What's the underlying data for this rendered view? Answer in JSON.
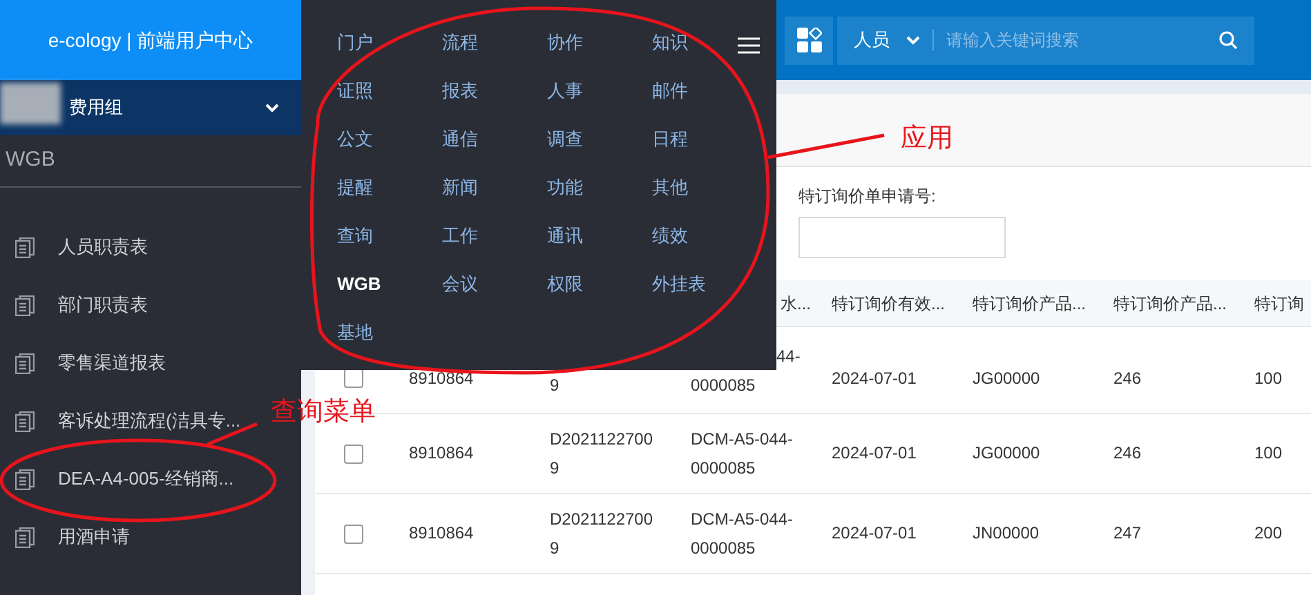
{
  "brand": "e-cology | 前端用户中心",
  "group_selector": {
    "label": "费用组"
  },
  "sidebar": {
    "section": "WGB",
    "items": [
      {
        "label": "人员职责表"
      },
      {
        "label": "部门职责表"
      },
      {
        "label": "零售渠道报表"
      },
      {
        "label": "客诉处理流程(洁具专..."
      },
      {
        "label": "DEA-A4-005-经销商..."
      },
      {
        "label": "用酒申请"
      }
    ]
  },
  "app_menu": {
    "items": [
      {
        "label": "门户",
        "selected": false
      },
      {
        "label": "流程",
        "selected": false
      },
      {
        "label": "协作",
        "selected": false
      },
      {
        "label": "知识",
        "selected": false
      },
      {
        "label": "证照",
        "selected": false
      },
      {
        "label": "报表",
        "selected": false
      },
      {
        "label": "人事",
        "selected": false
      },
      {
        "label": "邮件",
        "selected": false
      },
      {
        "label": "公文",
        "selected": false
      },
      {
        "label": "通信",
        "selected": false
      },
      {
        "label": "调查",
        "selected": false
      },
      {
        "label": "日程",
        "selected": false
      },
      {
        "label": "提醒",
        "selected": false
      },
      {
        "label": "新闻",
        "selected": false
      },
      {
        "label": "功能",
        "selected": false
      },
      {
        "label": "其他",
        "selected": false
      },
      {
        "label": "查询",
        "selected": false
      },
      {
        "label": "工作",
        "selected": false
      },
      {
        "label": "通讯",
        "selected": false
      },
      {
        "label": "绩效",
        "selected": false
      },
      {
        "label": "WGB",
        "selected": true
      },
      {
        "label": "会议",
        "selected": false
      },
      {
        "label": "权限",
        "selected": false
      },
      {
        "label": "外挂表",
        "selected": false
      },
      {
        "label": "基地",
        "selected": false
      }
    ]
  },
  "search": {
    "scope": "人员",
    "placeholder": "请输入关键词搜索"
  },
  "form": {
    "label": "特订询价单申请号:"
  },
  "table": {
    "columns": [
      {},
      {},
      {
        "label": "水..."
      },
      {
        "label": "特订询价有效..."
      },
      {
        "label": "特订询价产品..."
      },
      {
        "label": "特订询价产品..."
      },
      {
        "label": "特订询"
      }
    ],
    "rows": [
      {
        "checked": false,
        "cells": [
          {
            "text": "8910864",
            "kind": "full"
          },
          {
            "text": "9",
            "kind": "tail"
          },
          {
            "text": "44-\n0000085",
            "kind": "tail"
          },
          {
            "text": "2024-07-01",
            "kind": "full"
          },
          {
            "text": "JG00000",
            "kind": "full"
          },
          {
            "text": "246",
            "kind": "full"
          },
          {
            "text": "100",
            "kind": "full"
          }
        ]
      },
      {
        "checked": false,
        "cells": [
          {
            "text": "8910864",
            "kind": "full"
          },
          {
            "text": "D2021122700\n9",
            "kind": "full"
          },
          {
            "text": "DCM-A5-044-\n0000085",
            "kind": "full"
          },
          {
            "text": "2024-07-01",
            "kind": "full"
          },
          {
            "text": "JG00000",
            "kind": "full"
          },
          {
            "text": "246",
            "kind": "full"
          },
          {
            "text": "100",
            "kind": "full"
          }
        ]
      },
      {
        "checked": false,
        "cells": [
          {
            "text": "8910864",
            "kind": "full"
          },
          {
            "text": "D2021122700\n9",
            "kind": "full"
          },
          {
            "text": "DCM-A5-044-\n0000085",
            "kind": "full"
          },
          {
            "text": "2024-07-01",
            "kind": "full"
          },
          {
            "text": "JN00000",
            "kind": "full"
          },
          {
            "text": "247",
            "kind": "full"
          },
          {
            "text": "200",
            "kind": "full"
          }
        ]
      }
    ]
  },
  "annotations": [
    {
      "text": "应用"
    },
    {
      "text": "查询菜单"
    }
  ]
}
